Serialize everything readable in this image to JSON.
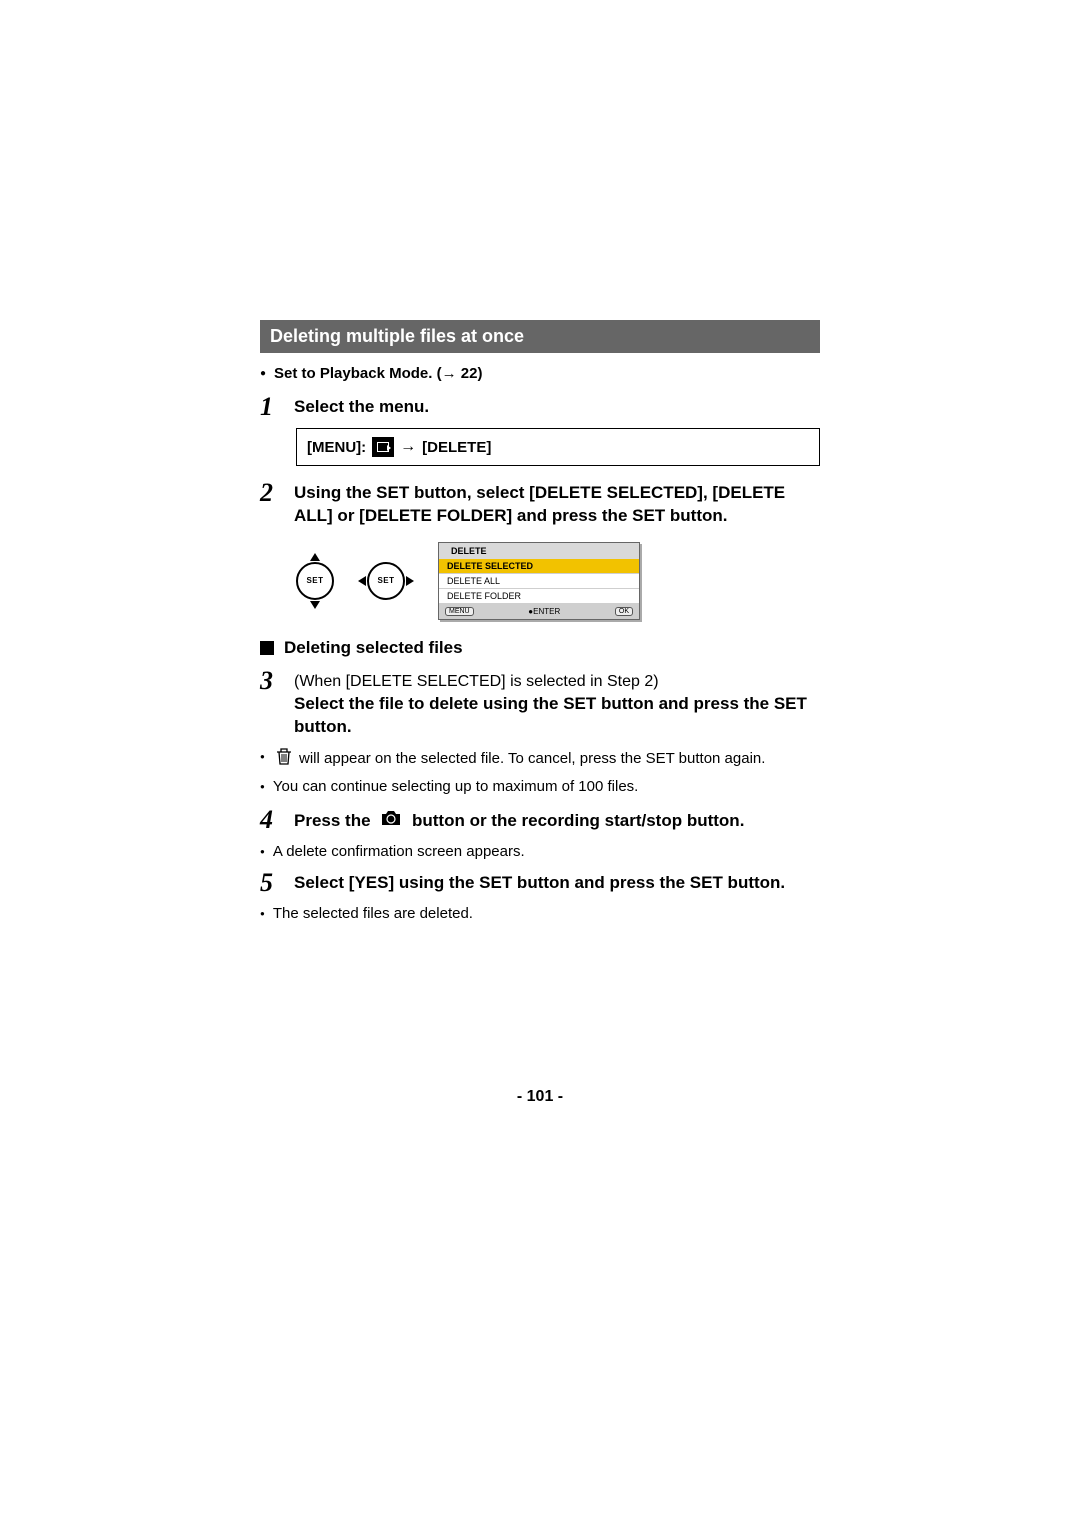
{
  "section_title": "Deleting multiple files at once",
  "precondition_prefix": "Set to Playback Mode. (",
  "precondition_arrow": "→",
  "precondition_page": " 22)",
  "steps": {
    "s1": {
      "num": "1",
      "text": "Select the menu."
    },
    "s2": {
      "num": "2",
      "text": "Using the SET button, select [DELETE SELECTED], [DELETE ALL] or [DELETE FOLDER] and press the SET button."
    },
    "s3": {
      "num": "3",
      "prefix_normal": "(When [DELETE SELECTED] is selected in Step 2)",
      "text_bold": "Select the file to delete using the SET button and press the SET button."
    },
    "s4": {
      "num": "4",
      "part1": "Press the ",
      "part2": " button or the recording start/stop button."
    },
    "s5": {
      "num": "5",
      "text": "Select [YES] using the SET button and press the SET button."
    }
  },
  "menu_box": {
    "label_menu": "[MENU]:",
    "arrow": "→",
    "label_delete": "[DELETE]"
  },
  "set_label": "SET",
  "lcd": {
    "title": "DELETE",
    "items": [
      "DELETE SELECTED",
      "DELETE ALL",
      "DELETE FOLDER"
    ],
    "menu_pill": "MENU",
    "enter": "ENTER",
    "ok_pill": "OK"
  },
  "subhead": "Deleting selected files",
  "bullets": {
    "b1_after_icon": " will appear on the selected file. To cancel, press the SET button again.",
    "b2": "You can continue selecting up to maximum of 100 files.",
    "b3": "A delete confirmation screen appears.",
    "b4": "The selected files are deleted."
  },
  "page_number": "- 101 -"
}
